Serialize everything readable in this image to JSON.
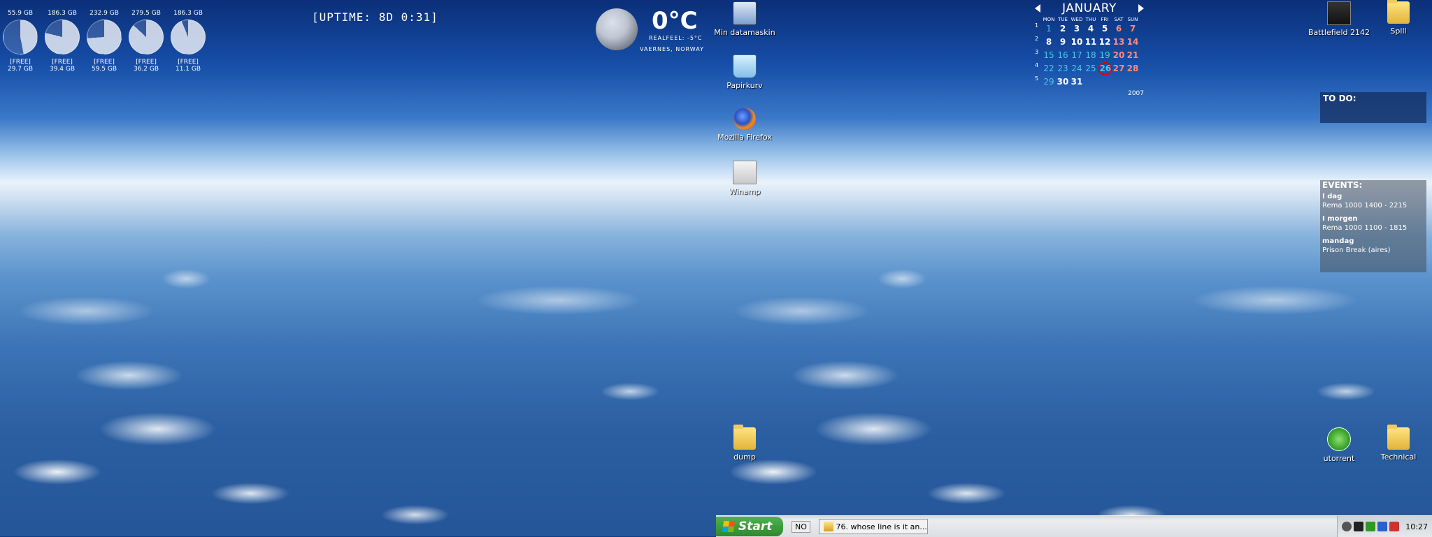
{
  "drives": [
    {
      "size": "55.9 GB",
      "free_label": "[FREE]",
      "free": "29.7 GB",
      "used_fraction": 0.47
    },
    {
      "size": "186.3 GB",
      "free_label": "[FREE]",
      "free": "39.4 GB",
      "used_fraction": 0.79
    },
    {
      "size": "232.9 GB",
      "free_label": "[FREE]",
      "free": "59.5 GB",
      "used_fraction": 0.74
    },
    {
      "size": "279.5 GB",
      "free_label": "[FREE]",
      "free": "36.2 GB",
      "used_fraction": 0.87
    },
    {
      "size": "186.3 GB",
      "free_label": "[FREE]",
      "free": "11.1 GB",
      "used_fraction": 0.94
    }
  ],
  "uptime": "[UPTIME: 8D 0:31]",
  "weather": {
    "temp": "0°C",
    "realfeel": "REALFEEL: -5°C",
    "location": "VAERNES, NORWAY"
  },
  "desktop_icons": [
    {
      "label": "Min datamaskin",
      "icon": "computer-icon"
    },
    {
      "label": "Papirkurv",
      "icon": "recycle-bin-icon"
    },
    {
      "label": "Mozilla Firefox",
      "icon": "firefox-icon"
    },
    {
      "label": "Winamp",
      "icon": "winamp-icon"
    },
    {
      "label": "dump",
      "icon": "folder-icon"
    },
    {
      "label": "Battlefield 2142",
      "icon": "game-icon"
    },
    {
      "label": "Spill",
      "icon": "folder-icon"
    },
    {
      "label": "utorrent",
      "icon": "utorrent-icon"
    },
    {
      "label": "Technical",
      "icon": "folder-icon"
    }
  ],
  "calendar": {
    "month": "JANUARY",
    "year": "2007",
    "weekdays": [
      "MON",
      "TUE",
      "WED",
      "THU",
      "FRI",
      "SAT",
      "SUN"
    ],
    "weeks": [
      {
        "num": "1",
        "days": [
          "1",
          "2",
          "3",
          "4",
          "5",
          "6",
          "7"
        ]
      },
      {
        "num": "2",
        "days": [
          "8",
          "9",
          "10",
          "11",
          "12",
          "13",
          "14"
        ]
      },
      {
        "num": "3",
        "days": [
          "15",
          "16",
          "17",
          "18",
          "19",
          "20",
          "21"
        ]
      },
      {
        "num": "4",
        "days": [
          "22",
          "23",
          "24",
          "25",
          "26",
          "27",
          "28"
        ]
      },
      {
        "num": "5",
        "days": [
          "29",
          "30",
          "31",
          "",
          "",
          "",
          ""
        ]
      }
    ],
    "today": "26"
  },
  "todo": {
    "title": "TO DO:"
  },
  "events": {
    "title": "EVENTS:",
    "items": [
      {
        "day": "I dag",
        "text": "Rema 1000 1400 - 2215"
      },
      {
        "day": "I morgen",
        "text": "Rema 1000 1100 - 1815"
      },
      {
        "day": "mandag",
        "text": "Prison Break (aires)"
      }
    ]
  },
  "taskbar": {
    "start": "Start",
    "language": "NO",
    "task": "76. whose line is it an...",
    "clock": "10:27"
  }
}
